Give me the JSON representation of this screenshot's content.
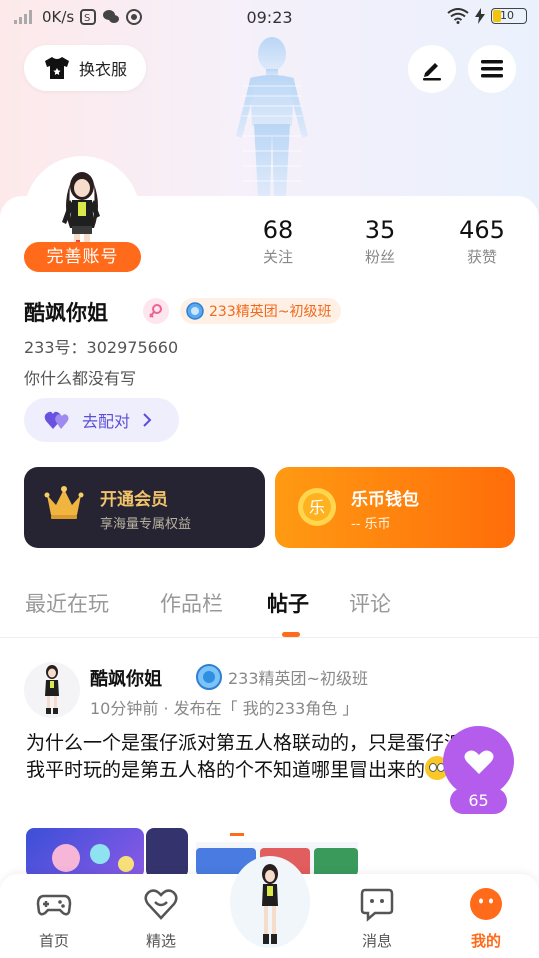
{
  "status_bar": {
    "network_speed": "0K/s",
    "time": "09:23",
    "battery": "10"
  },
  "header": {
    "dress_label": "换衣服",
    "edit_icon": "pen-icon",
    "menu_icon": "menu-icon"
  },
  "profile": {
    "complete_account_label": "完善账号",
    "stats": [
      {
        "num": "68",
        "label": "关注"
      },
      {
        "num": "35",
        "label": "粉丝"
      },
      {
        "num": "465",
        "label": "获赞"
      }
    ],
    "name": "酷飒你姐",
    "badge": "233精英团~初级班",
    "uid": "233号：302975660",
    "bio": "你什么都没有写",
    "pair_label": "去配对"
  },
  "cards": {
    "vip_title": "开通会员",
    "vip_sub": "享海量专属权益",
    "wallet_title": "乐币钱包",
    "wallet_sub": "-- 乐币",
    "wallet_icon_text": "乐"
  },
  "tabs": [
    {
      "label": "最近在玩"
    },
    {
      "label": "作品栏"
    },
    {
      "label": "帖子"
    },
    {
      "label": "评论"
    }
  ],
  "post": {
    "author": "酷飒你姐",
    "badge": "233精英团~初级班",
    "meta": "10分钟前 · 发布在「 我的233角色 」",
    "body": "为什么一个是蛋仔派对第五人格联动的，只是蛋仔派对，我平时玩的是第五人格的个不知道哪里冒出来的",
    "like_count": "65"
  },
  "nav": [
    {
      "label": "首页",
      "icon": "gamepad-icon"
    },
    {
      "label": "精选",
      "icon": "heart-smile-icon"
    },
    {
      "label": "消息",
      "icon": "message-icon"
    },
    {
      "label": "我的",
      "icon": "profile-face-icon"
    }
  ],
  "colors": {
    "accent": "#ff6b1a",
    "like": "#b45ceb",
    "pair": "#5b4fd6",
    "vip_bg": "#262432"
  }
}
